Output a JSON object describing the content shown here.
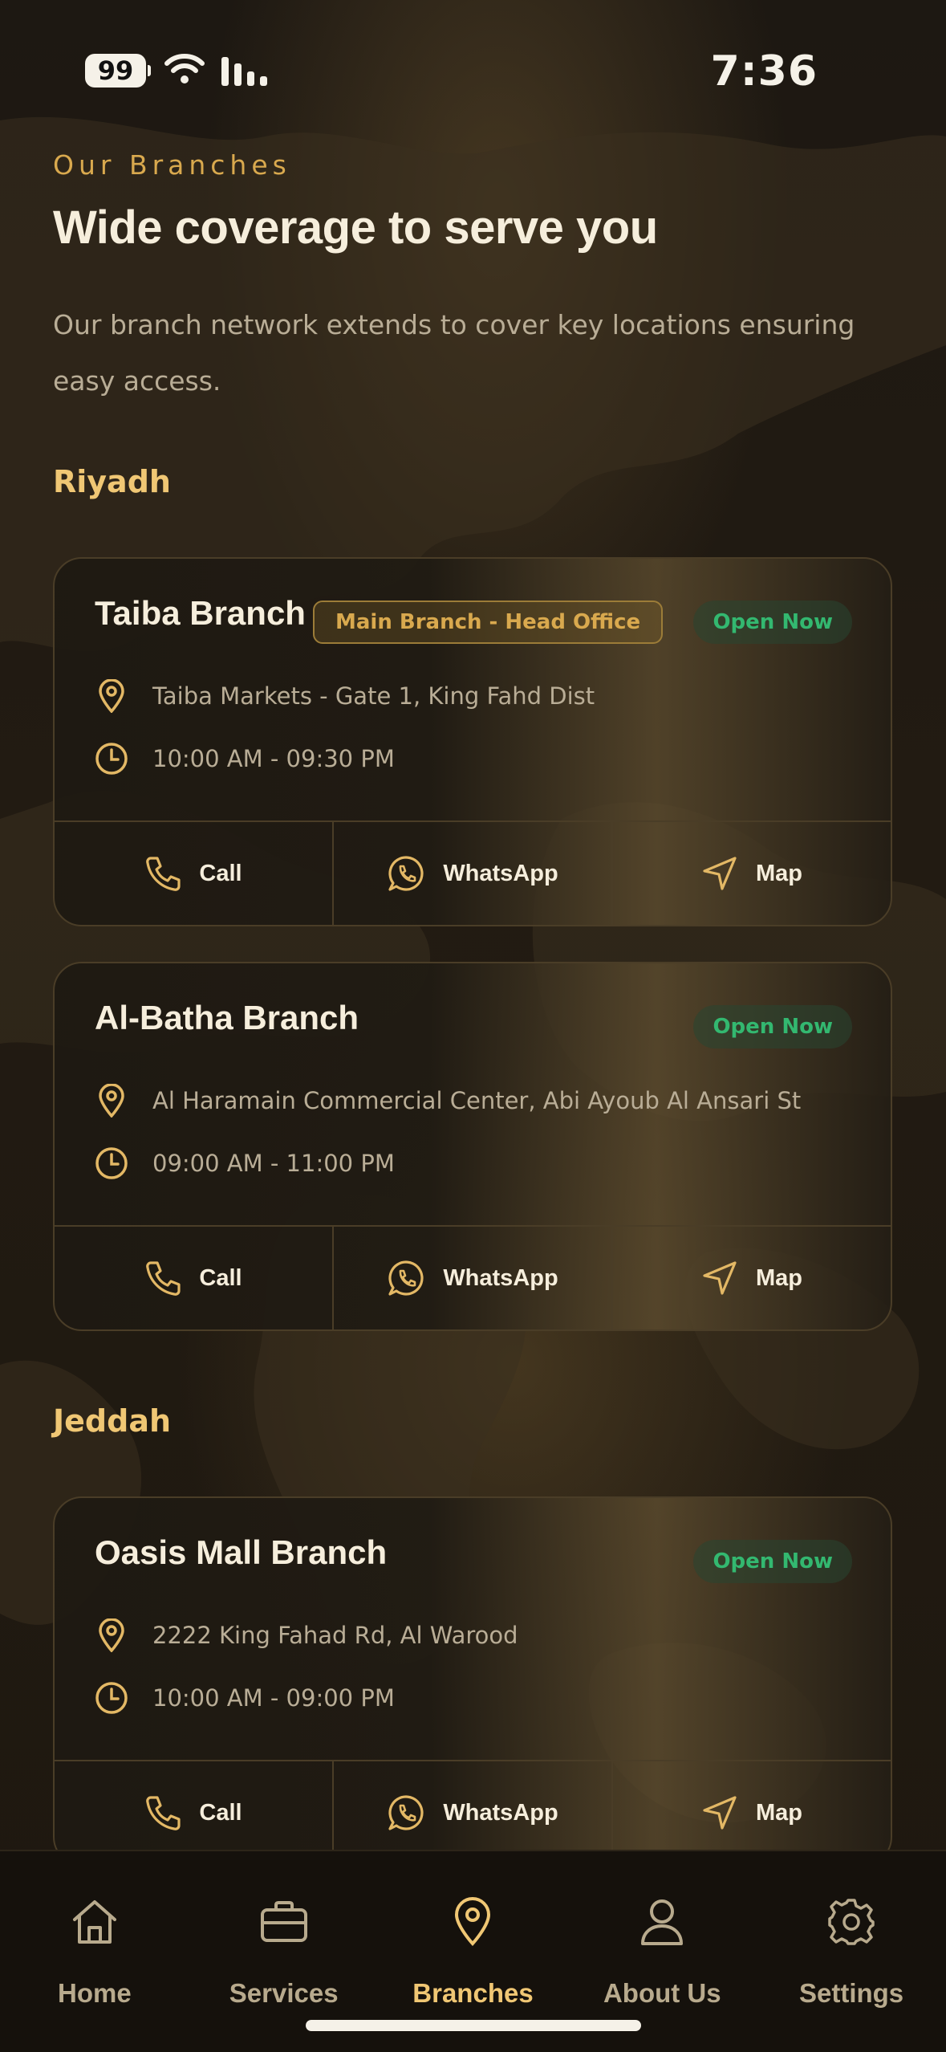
{
  "status": {
    "battery": "99",
    "time": "7:36"
  },
  "header": {
    "eyebrow": "Our Branches",
    "title": "Wide coverage to serve you",
    "lead": "Our branch network extends to cover key locations ensuring easy access."
  },
  "cities": [
    {
      "name": "Riyadh",
      "branches": [
        {
          "name": "Taiba Branch",
          "badge": "Main Branch - Head Office",
          "status": "Open Now",
          "address": "Taiba Markets - Gate 1, King Fahd Dist",
          "hours": "10:00 AM - 09:30 PM"
        },
        {
          "name": "Al-Batha Branch",
          "status": "Open Now",
          "address": "Al Haramain Commercial Center, Abi Ayoub Al Ansari St",
          "hours": "09:00 AM - 11:00 PM"
        }
      ]
    },
    {
      "name": "Jeddah",
      "branches": [
        {
          "name": "Oasis Mall Branch",
          "status": "Open Now",
          "address": "2222 King Fahad Rd, Al Warood",
          "hours": "10:00 AM - 09:00 PM"
        }
      ]
    }
  ],
  "actions": {
    "call": "Call",
    "whatsapp": "WhatsApp",
    "map": "Map"
  },
  "tabs": [
    {
      "label": "Home",
      "icon": "home-icon"
    },
    {
      "label": "Services",
      "icon": "briefcase-icon"
    },
    {
      "label": "Branches",
      "icon": "location-pin-icon"
    },
    {
      "label": "About Us",
      "icon": "user-icon"
    },
    {
      "label": "Settings",
      "icon": "gear-icon"
    }
  ],
  "active_tab": "Branches",
  "colors": {
    "accent": "#f0c774",
    "eyebrow": "#d9a94e",
    "open_green": "#33b870",
    "background": "#1a150f"
  }
}
